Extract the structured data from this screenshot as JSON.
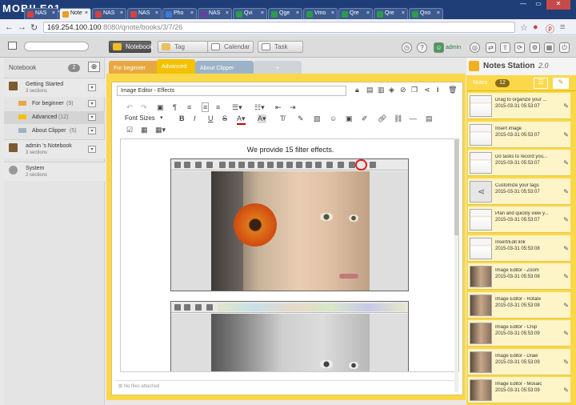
{
  "watermark": "MOBILE01",
  "browser": {
    "tabs": [
      {
        "label": "NAS",
        "color": "#d94040"
      },
      {
        "label": "Note",
        "color": "#e8a020",
        "active": true
      },
      {
        "label": "NAS",
        "color": "#d94040"
      },
      {
        "label": "NAS",
        "color": "#d94040"
      },
      {
        "label": "Pho",
        "color": "#3a7bd5"
      },
      {
        "label": "NAS",
        "color": "#6a3fa0"
      },
      {
        "label": "Qvi",
        "color": "#2a9d4a"
      },
      {
        "label": "Qge",
        "color": "#2a9d4a"
      },
      {
        "label": "Vmo",
        "color": "#2a9d4a"
      },
      {
        "label": "Qre",
        "color": "#2a9d4a"
      },
      {
        "label": "Qre",
        "color": "#2a9d4a"
      },
      {
        "label": "Qno",
        "color": "#2a9d4a"
      }
    ],
    "url_host": "169.254.100.100",
    "url_path": ":8080/qnote/books/3/7/26"
  },
  "header": {
    "notebook_btn": "Notebook",
    "tag_btn": "Tag",
    "calendar_btn": "Calendar",
    "task_btn": "Task",
    "user": "admin"
  },
  "sidebar": {
    "title": "Notebook",
    "count": "2",
    "items": [
      {
        "title": "Getting Started",
        "sub": "3 sections"
      },
      {
        "title": "For beginner",
        "count": "(9)"
      },
      {
        "title": "Advanced",
        "count": "(12)"
      },
      {
        "title": "About Clipper",
        "count": "(5)"
      },
      {
        "title": "admin 's Notebook",
        "sub": "3 sections"
      },
      {
        "title": "System",
        "sub": "2 sections"
      }
    ]
  },
  "note_tabs": [
    "For beginner",
    "Advanced",
    "About Clipper",
    "+"
  ],
  "editor": {
    "title": "Image Editor - Effects",
    "font_sizes": "Font Sizes",
    "caption": "We provide 15 filter effects.",
    "attach": "No files attached"
  },
  "notes_panel": {
    "title": "Notes Station",
    "version": "2.0",
    "tab": "Notes",
    "count": "12",
    "items": [
      {
        "title": "Drag to organize your ...",
        "date": "2015-03-31 05:53:07"
      },
      {
        "title": "Insert image",
        "date": "2015-03-31 05:53:07"
      },
      {
        "title": "Do tasks to record you...",
        "date": "2015-03-31 05:53:07"
      },
      {
        "title": "Customize your tags",
        "date": "2015-03-31 05:53:07"
      },
      {
        "title": "Plan and quickly view y...",
        "date": "2015-03-31 05:53:07"
      },
      {
        "title": "Insert/Edit link",
        "date": "2015-03-31 05:53:08"
      },
      {
        "title": "Image Editor - Zoom",
        "date": "2015-03-31 05:53:08"
      },
      {
        "title": "Image Editor - Rotate",
        "date": "2015-03-31 05:53:08"
      },
      {
        "title": "Image Editor - Crop",
        "date": "2015-03-31 05:53:09"
      },
      {
        "title": "Image Editor - Draw",
        "date": "2015-03-31 05:53:09"
      },
      {
        "title": "Image Editor - Mosaic",
        "date": "2015-03-31 05:53:09"
      }
    ]
  },
  "colors": {
    "accent": "#fbd84a",
    "advanced_tab": "#f2c200",
    "beginner_tab": "#e8a840",
    "clipper_tab": "#9bb3c9"
  }
}
